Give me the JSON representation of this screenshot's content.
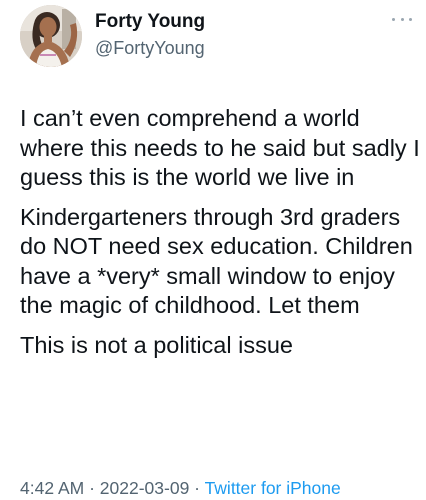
{
  "tweet": {
    "author": {
      "display_name": "Forty Young",
      "handle": "@FortyYoung"
    },
    "menu_icon": "more-horizontal-icon",
    "paragraphs": [
      "I can’t even comprehend a world where this needs to he said but sadly I guess this is the world we live in",
      "Kindergarteners through 3rd graders do NOT need sex education. Children have a *very* small window to enjoy the magic of childhood. Let them",
      "This is not a political issue"
    ],
    "time": "4:42 AM",
    "separator": " · ",
    "date": "2022-03-09",
    "source": "Twitter for iPhone"
  },
  "colors": {
    "text_primary": "#0f1419",
    "text_secondary": "#536471",
    "link": "#1d9bf0"
  }
}
